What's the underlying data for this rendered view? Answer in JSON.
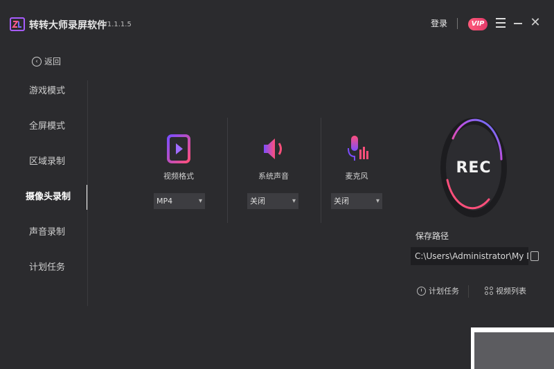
{
  "app": {
    "name": "转转大师录屏软件",
    "version": "V1.1.1.5"
  },
  "titlebar": {
    "login": "登录",
    "vip": "VIP"
  },
  "sidebar": {
    "back": "返回",
    "items": [
      {
        "label": "游戏模式"
      },
      {
        "label": "全屏模式"
      },
      {
        "label": "区域录制"
      },
      {
        "label": "摄像头录制",
        "active": true
      },
      {
        "label": "声音录制"
      },
      {
        "label": "计划任务"
      }
    ]
  },
  "options": {
    "video_format": {
      "label": "视频格式",
      "value": "MP4"
    },
    "system_audio": {
      "label": "系统声音",
      "value": "关闭"
    },
    "microphone": {
      "label": "麦克风",
      "value": "关闭"
    }
  },
  "rec": {
    "label": "REC"
  },
  "save": {
    "label": "保存路径",
    "path": "C:\\Users\\Administrator\\My Documents"
  },
  "bottom": {
    "scheduled": "计划任务",
    "video_list": "视频列表"
  },
  "colors": {
    "bg": "#2b2b2e",
    "accent_pink": "#ff4f7b",
    "accent_purple": "#7b4dff",
    "accent_blue": "#4f7bff"
  }
}
